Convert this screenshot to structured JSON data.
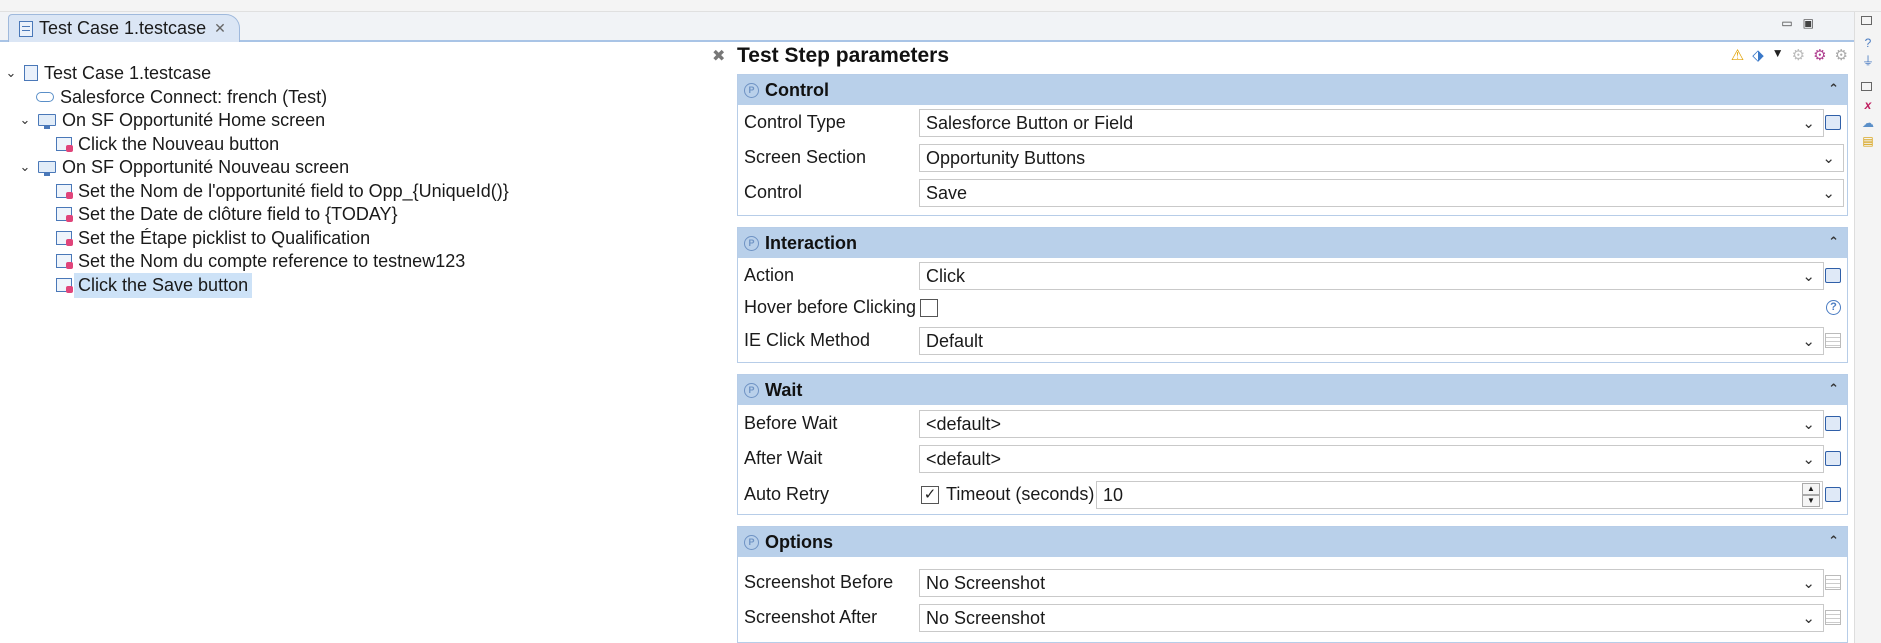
{
  "editor_tab": {
    "label": "Test Case 1.testcase",
    "close": "✕"
  },
  "window_buttons": {
    "minimize": "▭",
    "maximize": "▣"
  },
  "tree": {
    "collapse_all": "✖",
    "items": [
      {
        "label": "Test Case 1.testcase",
        "twistie": "⌄",
        "icon": "testcase-file-icon"
      },
      {
        "label": "Salesforce Connect: french (Test)",
        "icon": "cloud-icon"
      },
      {
        "label": "On SF Opportunité Home screen",
        "twistie": "⌄",
        "icon": "screen-icon"
      },
      {
        "label": "Click the Nouveau button",
        "icon": "test-step-icon"
      },
      {
        "label": "On SF Opportunité Nouveau screen",
        "twistie": "⌄",
        "icon": "screen-icon"
      },
      {
        "label": "Set the Nom de l'opportunité field to Opp_{UniqueId()}",
        "icon": "test-step-icon"
      },
      {
        "label": "Set the Date de clôture field to {TODAY}",
        "icon": "test-step-icon"
      },
      {
        "label": "Set the Étape picklist to Qualification",
        "icon": "test-step-icon"
      },
      {
        "label": "Set the Nom du compte reference to testnew123",
        "icon": "test-step-icon"
      },
      {
        "label": "Click the Save button",
        "icon": "test-step-icon",
        "selected": true
      }
    ]
  },
  "params": {
    "title": "Test Step parameters",
    "title_icons": [
      "warning-icon",
      "tag-icon",
      "dropdown-arrow-icon",
      "gear-disabled-icon",
      "gear-colored-icon",
      "gear-grey-icon"
    ],
    "sections": {
      "control": {
        "title": "Control",
        "rows": [
          {
            "label": "Control Type",
            "value": "Salesforce Button or Field"
          },
          {
            "label": "Screen Section",
            "value": "Opportunity Buttons"
          },
          {
            "label": "Control",
            "value": "Save"
          }
        ]
      },
      "interaction": {
        "title": "Interaction",
        "action_label": "Action",
        "action_value": "Click",
        "hover_label": "Hover before Clicking",
        "hover_checked": false,
        "ie_label": "IE Click Method",
        "ie_value": "Default"
      },
      "wait": {
        "title": "Wait",
        "before_label": "Before Wait",
        "before_value": "<default>",
        "after_label": "After Wait",
        "after_value": "<default>",
        "retry_label": "Auto Retry",
        "retry_checked": true,
        "timeout_label": "Timeout (seconds)",
        "timeout_value": "10"
      },
      "options": {
        "title": "Options",
        "before_label": "Screenshot Before",
        "before_value": "No Screenshot",
        "after_label": "Screenshot After",
        "after_value": "No Screenshot"
      }
    }
  },
  "glyphs": {
    "combo_arrow": "⌄",
    "collapse": "⌃",
    "check": "✓",
    "help": "?",
    "spin_up": "▲",
    "spin_down": "▼",
    "section_icon": "P"
  }
}
